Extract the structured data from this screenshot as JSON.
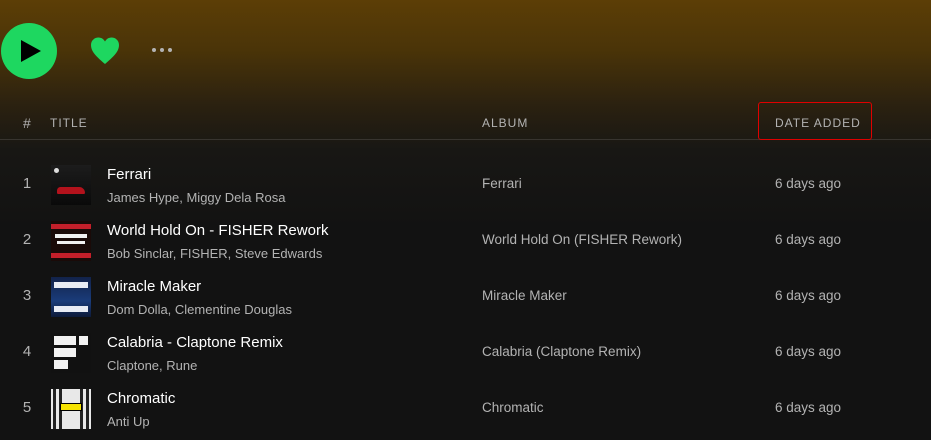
{
  "header": {
    "index_label": "#",
    "title_label": "Title",
    "album_label": "Album",
    "date_label": "Date added"
  },
  "colors": {
    "accent": "#1ed760",
    "highlight_box": "#e00000"
  },
  "icons": {
    "play": "play-icon",
    "heart": "heart-icon",
    "more": "more-options-icon"
  },
  "tracks": [
    {
      "index": "1",
      "name": "Ferrari",
      "artists": "James Hype, Miggy Dela Rosa",
      "album": "Ferrari",
      "date_added": "6 days ago"
    },
    {
      "index": "2",
      "name": "World Hold On - FISHER Rework",
      "artists": "Bob Sinclar, FISHER, Steve Edwards",
      "album": "World Hold On (FISHER Rework)",
      "date_added": "6 days ago"
    },
    {
      "index": "3",
      "name": "Miracle Maker",
      "artists": "Dom Dolla, Clementine Douglas",
      "album": "Miracle Maker",
      "date_added": "6 days ago"
    },
    {
      "index": "4",
      "name": "Calabria - Claptone Remix",
      "artists": "Claptone, Rune",
      "album": "Calabria (Claptone Remix)",
      "date_added": "6 days ago"
    },
    {
      "index": "5",
      "name": "Chromatic",
      "artists": "Anti Up",
      "album": "Chromatic",
      "date_added": "6 days ago"
    }
  ]
}
